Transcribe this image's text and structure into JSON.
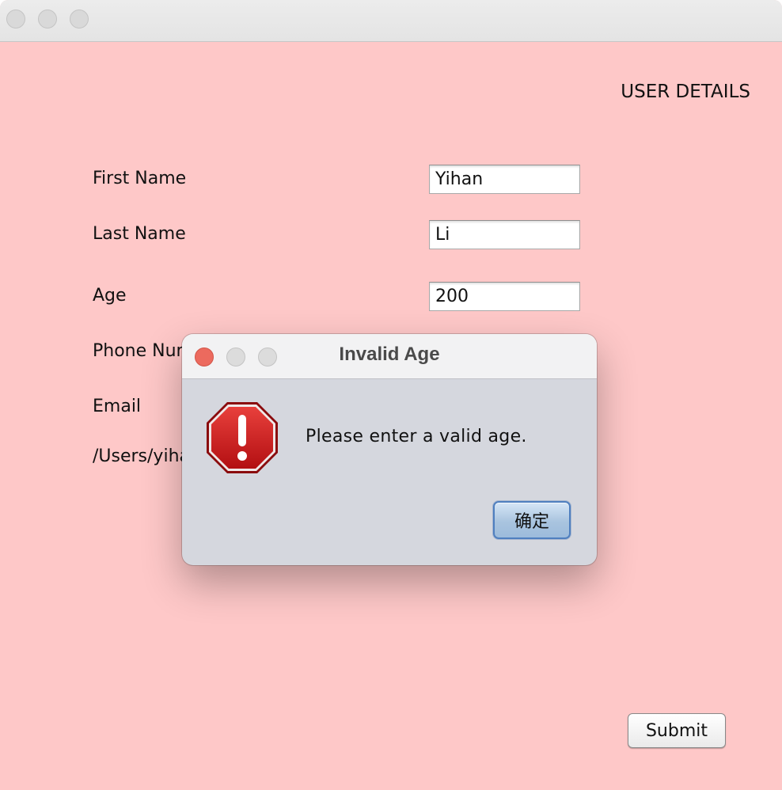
{
  "window": {
    "background": "#fec8c8",
    "heading": "USER DETAILS"
  },
  "form": {
    "first_name": {
      "label": "First Name",
      "value": "Yihan"
    },
    "last_name": {
      "label": "Last Name",
      "value": "Li"
    },
    "age": {
      "label": "Age",
      "value": "200"
    },
    "phone": {
      "label": "Phone Number"
    },
    "email": {
      "label": "Email"
    },
    "path_label": "/Users/yihanli"
  },
  "submit_label": "Submit",
  "dialog": {
    "title": "Invalid Age",
    "message": "Please enter a valid age.",
    "ok_label": "确定",
    "icon": "error-stop-icon",
    "close_color": "#ec6a5e"
  }
}
